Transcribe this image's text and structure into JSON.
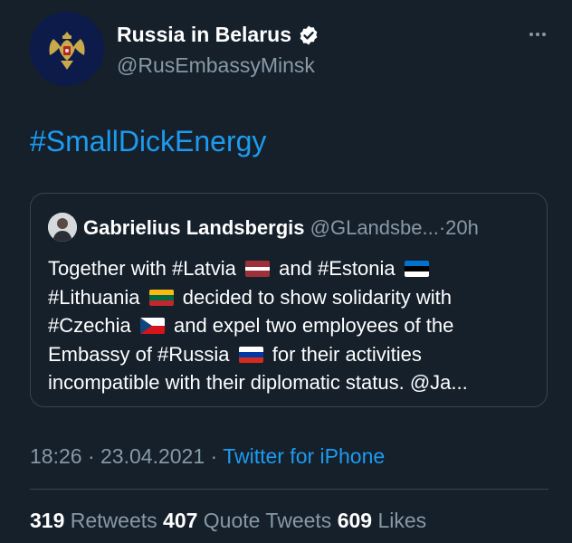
{
  "author": {
    "display_name": "Russia in Belarus",
    "handle": "@RusEmbassyMinsk",
    "verified": true,
    "avatar_icon": "russian-coat-of-arms-icon"
  },
  "tweet": {
    "text": "#SmallDickEnergy"
  },
  "quoted_tweet": {
    "name": "Gabrielius Landsbergis",
    "handle": "@GLandsbe...",
    "separator": "·",
    "time": "20h",
    "lines": [
      {
        "before": "Together with #Latvia",
        "flag": "latvia-flag-icon",
        "after": "and #Estonia",
        "flag2": "estonia-flag-icon"
      },
      {
        "before": "#Lithuania",
        "flag": "lithuania-flag-icon",
        "after": "decided to show solidarity with"
      },
      {
        "before": "#Czechia",
        "flag": "czechia-flag-icon",
        "after": "and expel two employees of the"
      },
      {
        "before": "Embassy of #Russia",
        "flag": "russia-flag-icon",
        "after": "for their activities"
      },
      {
        "before": "incompatible with their diplomatic status. @Ja..."
      }
    ]
  },
  "meta": {
    "time": "18:26",
    "date": "23.04.2021",
    "separator": "·",
    "source": "Twitter for iPhone"
  },
  "stats": {
    "retweets_count": "319",
    "retweets_label": "Retweets",
    "quote_count": "407",
    "quote_label": "Quote Tweets",
    "likes_count": "609",
    "likes_label": "Likes"
  },
  "colors": {
    "background": "#15202b",
    "accent": "#1d9bf0",
    "muted": "#8899a6",
    "border": "#38444d"
  }
}
